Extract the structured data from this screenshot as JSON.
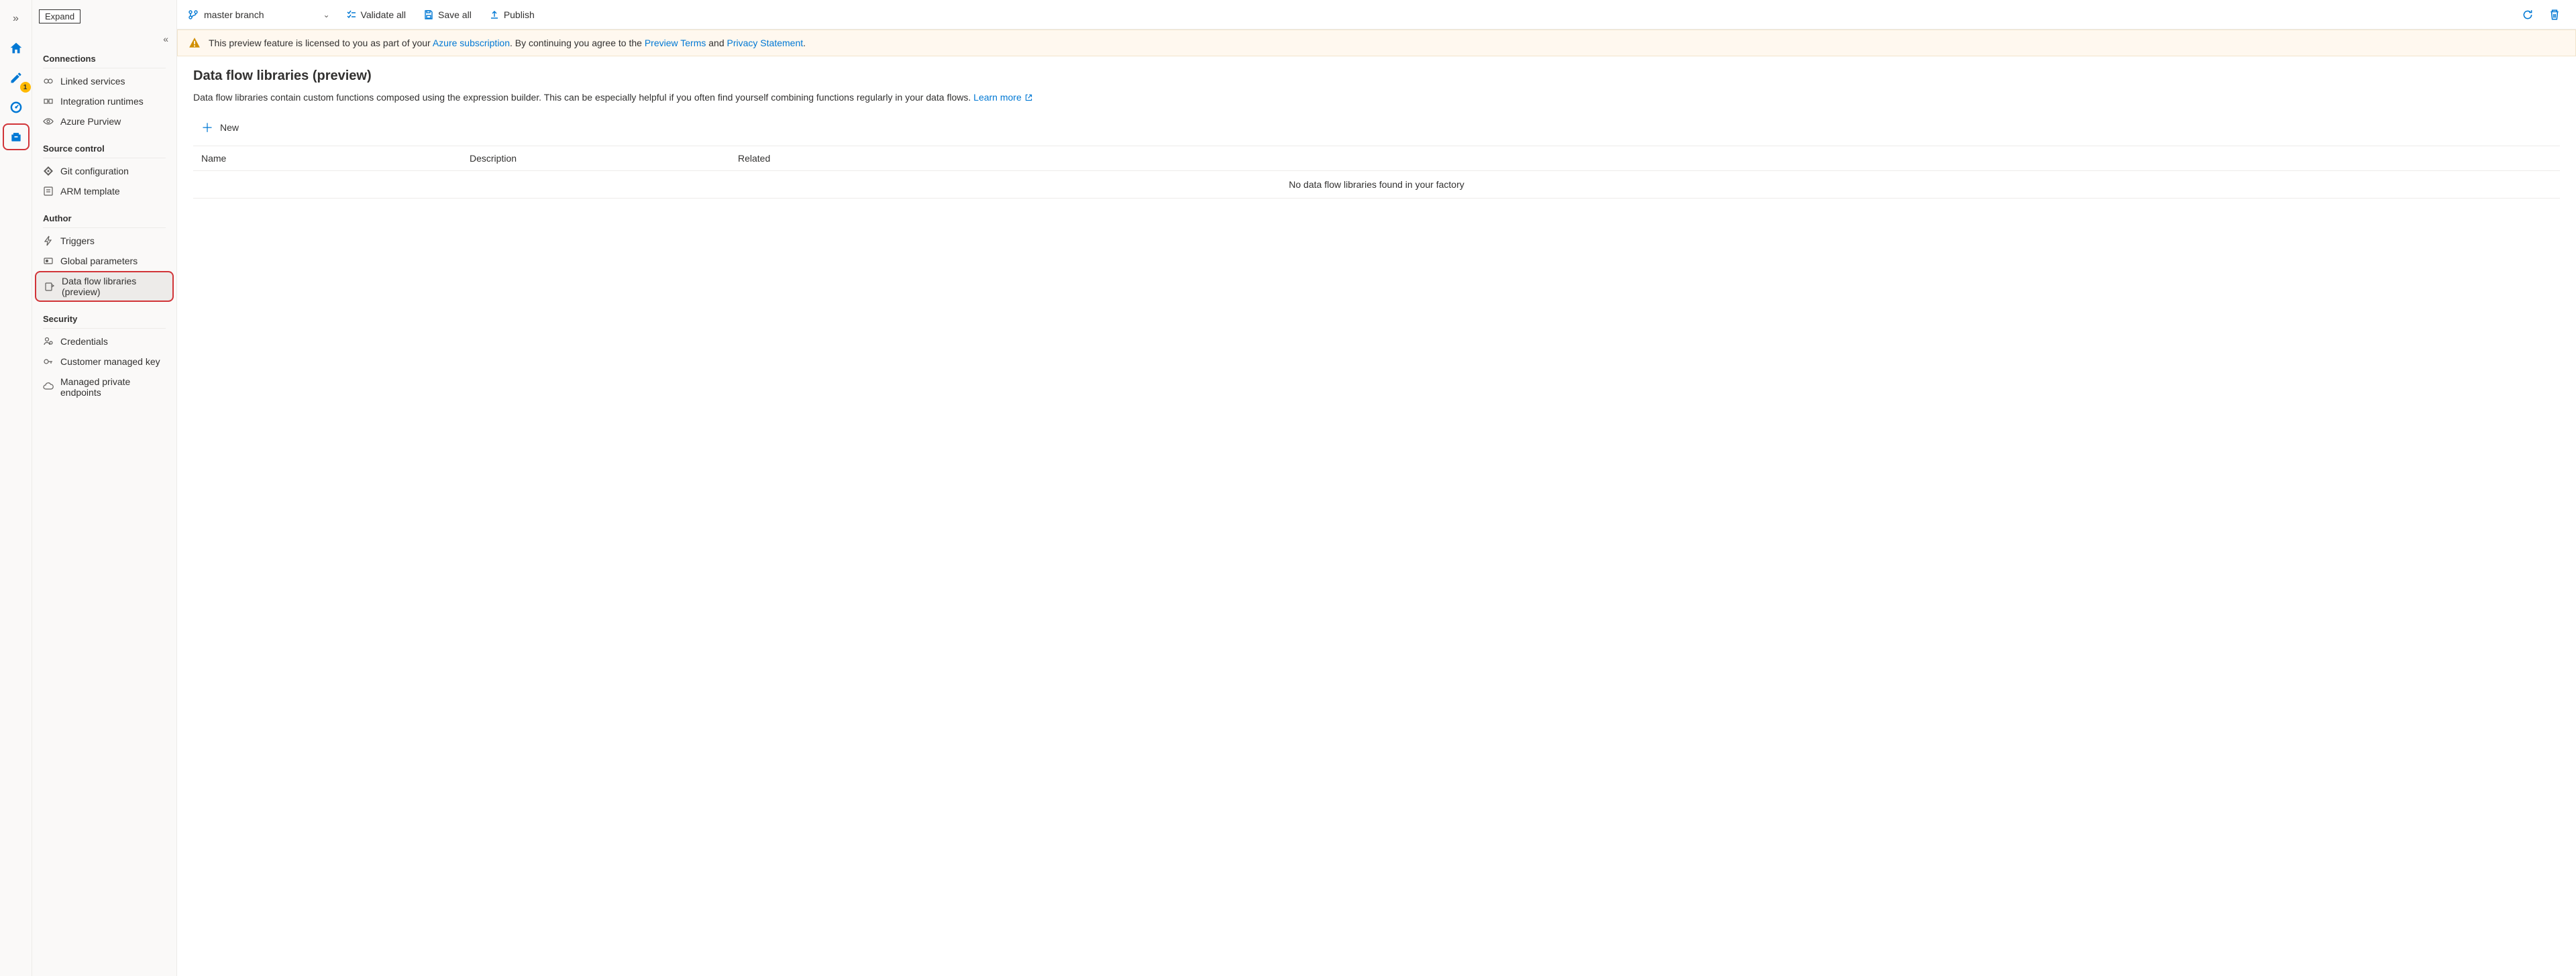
{
  "rail": {
    "expand_tooltip": "Expand",
    "author_badge": "1"
  },
  "toolbar": {
    "branch_label": "master branch",
    "validate_label": "Validate all",
    "save_label": "Save all",
    "publish_label": "Publish"
  },
  "notice": {
    "text_before": "This preview feature is licensed to you as part of your ",
    "azure_sub": "Azure subscription",
    "text_mid1": ". By continuing you agree to the ",
    "preview_terms": "Preview Terms",
    "text_mid2": " and ",
    "privacy": "Privacy Statement",
    "text_end": "."
  },
  "sidebar": {
    "sections": {
      "connections": {
        "title": "Connections",
        "items": [
          {
            "label": "Linked services"
          },
          {
            "label": "Integration runtimes"
          },
          {
            "label": "Azure Purview"
          }
        ]
      },
      "source_control": {
        "title": "Source control",
        "items": [
          {
            "label": "Git configuration"
          },
          {
            "label": "ARM template"
          }
        ]
      },
      "author": {
        "title": "Author",
        "items": [
          {
            "label": "Triggers"
          },
          {
            "label": "Global parameters"
          },
          {
            "label": "Data flow libraries (preview)"
          }
        ]
      },
      "security": {
        "title": "Security",
        "items": [
          {
            "label": "Credentials"
          },
          {
            "label": "Customer managed key"
          },
          {
            "label": "Managed private endpoints"
          }
        ]
      }
    }
  },
  "page": {
    "title": "Data flow libraries (preview)",
    "description": "Data flow libraries contain custom functions composed using the expression builder. This can be especially helpful if you often find yourself combining functions regularly in your data flows. ",
    "learn_more": "Learn more",
    "new_label": "New",
    "table": {
      "headers": {
        "name": "Name",
        "description": "Description",
        "related": "Related"
      },
      "empty": "No data flow libraries found in your factory"
    }
  }
}
